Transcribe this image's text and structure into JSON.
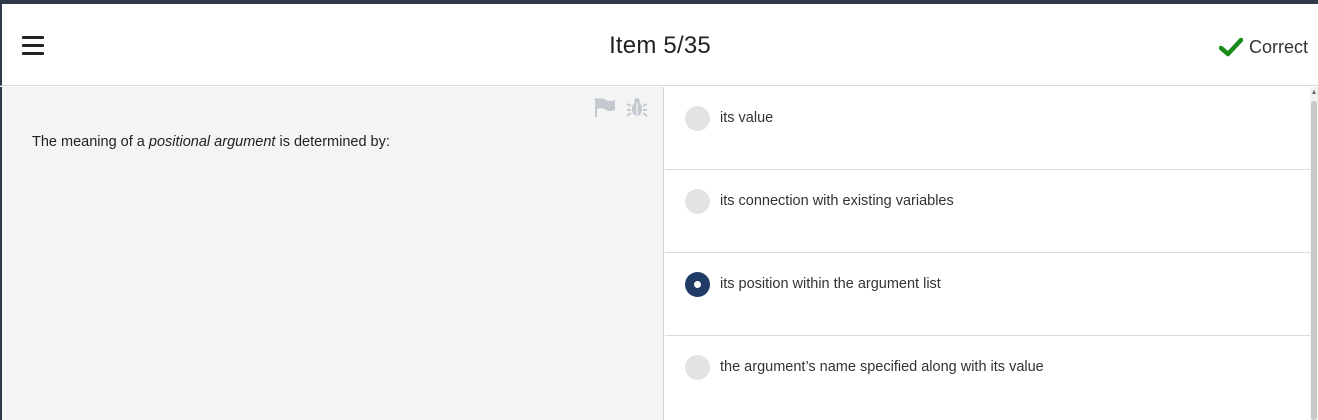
{
  "header": {
    "title": "Item 5/35",
    "status_label": "Correct",
    "status_color": "#1a8a1a",
    "menu_icon": "hamburger-icon",
    "status_icon": "check-icon"
  },
  "question": {
    "text_before": "The meaning of a ",
    "text_emphasis": "positional argument",
    "text_after": " is determined by:",
    "tools": [
      "flag-icon",
      "bug-icon"
    ]
  },
  "options": [
    {
      "label": "its value",
      "selected": false
    },
    {
      "label": "its connection with existing variables",
      "selected": false
    },
    {
      "label": "its position within the argument list",
      "selected": true
    },
    {
      "label": "the argument’s name specified along with its value",
      "selected": false
    }
  ],
  "colors": {
    "accent": "#1f3b66",
    "frame": "#2e3a4b",
    "left_pane_bg": "#f4f4f4"
  }
}
